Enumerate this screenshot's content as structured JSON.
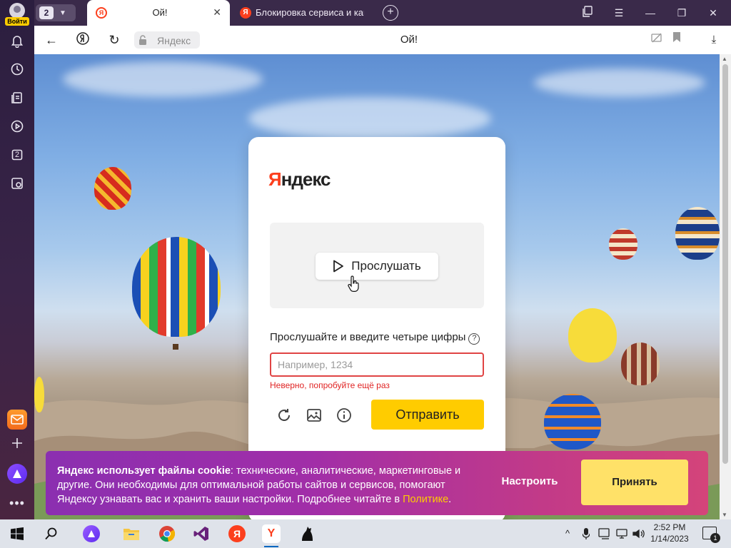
{
  "sidebar": {
    "login_label": "Войти",
    "items": [
      "bell-icon",
      "history-icon",
      "collections-icon",
      "video-icon",
      "tabs-count-icon",
      "screenshot-icon"
    ],
    "tabs_badge": "2"
  },
  "tabs": {
    "count": "2",
    "active": {
      "title": "Ой!",
      "favicon": "Я"
    },
    "second": {
      "title": "Блокировка сервиса и капча",
      "favicon": "Я"
    }
  },
  "address": {
    "url": "Яндекс",
    "page_title": "Ой!"
  },
  "captcha": {
    "logo_first": "Я",
    "logo_rest": "ндекс",
    "listen_label": "Прослушать",
    "prompt": "Прослушайте и введите четыре цифры",
    "input_placeholder": "Например, 1234",
    "input_value": "",
    "error_text": "Неверно, попробуйте ещё раз",
    "submit_label": "Отправить"
  },
  "cookie": {
    "bold": "Яндекс использует файлы cookie",
    "text": ": технические, аналитические, маркетинговые и другие. Они необходимы для оптимальной работы сайтов и сервисов, помогают Яндексу узнавать вас и хранить ваши настройки. Подробнее читайте в ",
    "link": "Политике",
    "end": ".",
    "configure_label": "Настроить",
    "accept_label": "Принять"
  },
  "taskbar": {
    "time": "2:52 PM",
    "date": "1/14/2023",
    "notifications": "1"
  },
  "colors": {
    "accent": "#ffcc00",
    "brand_red": "#fc3f1d",
    "error": "#e02424"
  }
}
